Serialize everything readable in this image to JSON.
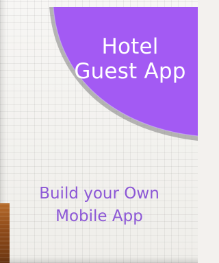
{
  "badge": {
    "title_line1": "Hotel",
    "title_line2": "Guest App",
    "fill_color": "#a35af3",
    "shadow_color": "#7f7f7f"
  },
  "cta": {
    "line1": "Build your Own",
    "line2": "Mobile App",
    "text_color": "#8c57d6"
  },
  "background": {
    "panel_color": "#f3f1ee",
    "wood_color": "#a35d22"
  }
}
